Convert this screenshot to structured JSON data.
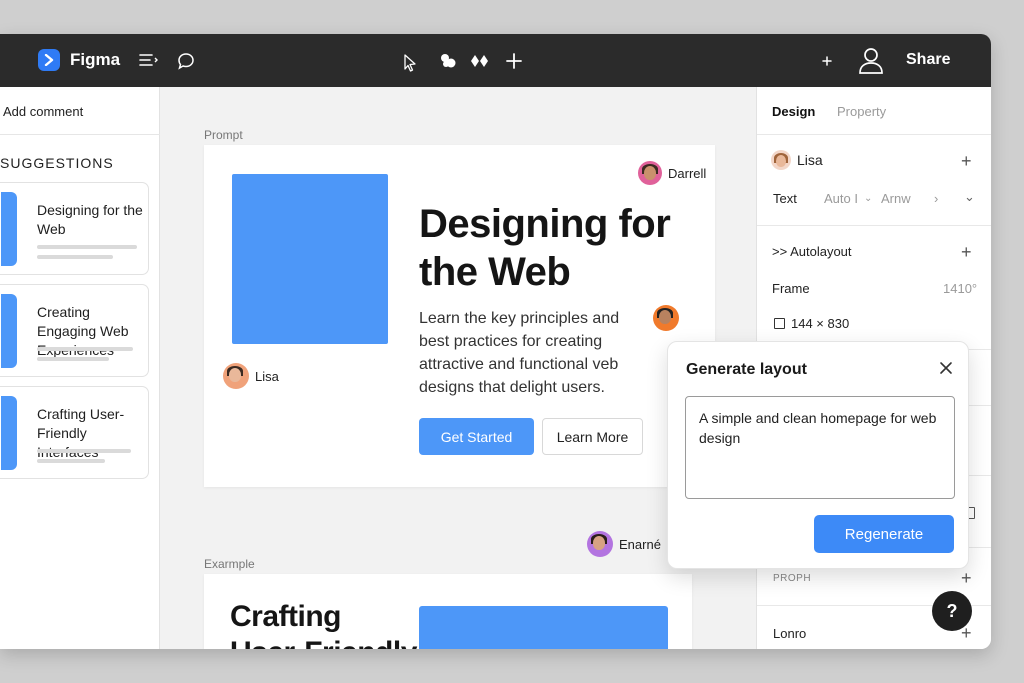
{
  "app": {
    "name": "Figma",
    "share_label": "Share"
  },
  "topbar": {
    "icons": [
      "menu-icon",
      "figma-logo-icon",
      "layers-list-icon",
      "comment-icon",
      "pointer-icon",
      "component-icon",
      "shape-tools-icon",
      "add-icon",
      "small-plus-icon",
      "user-icon"
    ]
  },
  "left_panel": {
    "add_comment": "Add comment",
    "suggestions_title": "SUGGESTIONS",
    "items": [
      {
        "label": "Designing for the Web"
      },
      {
        "label": "Creating Engaging Web Experiences"
      },
      {
        "label": "Crafting User-Friendly Interfaces"
      }
    ]
  },
  "canvas": {
    "prompt_label": "Prompt",
    "hero": {
      "title": "Designing for the Web",
      "description": "Learn the key principles and best practices for creating attractive and functional veb designs that delight users.",
      "primary_button": "Get Started",
      "secondary_button": "Learn More"
    },
    "collaborators": {
      "darrell": "Darrell",
      "lisa": "Lisa",
      "enarne": "Enarné"
    },
    "example_label": "Exarmple",
    "example": {
      "title": "Crafting User-Friendly Interfaces"
    }
  },
  "right_panel": {
    "tabs": [
      {
        "label": "Design",
        "active": true
      },
      {
        "label": "Property",
        "active": false
      }
    ],
    "user": "Lisa",
    "text_row": {
      "label": "Text",
      "auto": "Auto I",
      "font": "Arnw"
    },
    "autolayout": ">> Autolayout",
    "frame": {
      "label": "Frame",
      "value": "1410°"
    },
    "size": "144 × 830",
    "proph": "PROPH",
    "lonro": "Lonro"
  },
  "popup": {
    "title": "Generate layout",
    "prompt_value": "A simple and clean homepage for web design",
    "regenerate": "Regenerate"
  },
  "help": "?",
  "colors": {
    "accent": "#4d97f8",
    "topbar": "#2b2b2b",
    "primary_button": "#3d8af7"
  }
}
